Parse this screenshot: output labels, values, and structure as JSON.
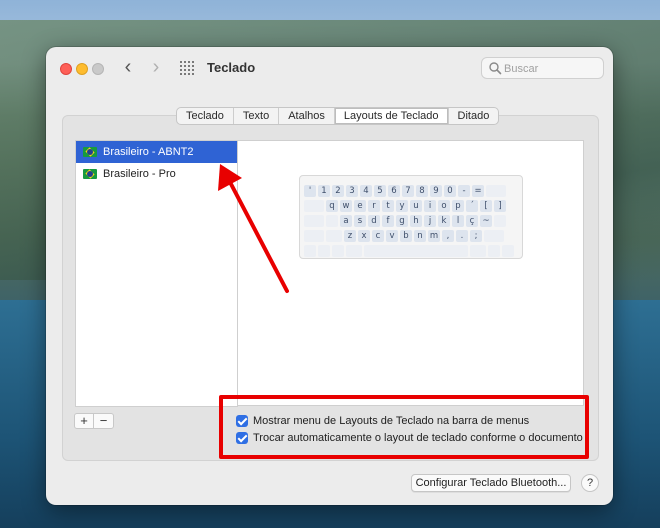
{
  "window": {
    "title": "Teclado",
    "search_placeholder": "Buscar"
  },
  "tabs": [
    {
      "label": "Teclado",
      "active": false
    },
    {
      "label": "Texto",
      "active": false
    },
    {
      "label": "Atalhos",
      "active": false
    },
    {
      "label": "Layouts de Teclado",
      "active": true
    },
    {
      "label": "Ditado",
      "active": false
    }
  ],
  "layouts": [
    {
      "label": "Brasileiro - ABNT2",
      "selected": true,
      "icon": "brazil-flag-icon"
    },
    {
      "label": "Brasileiro - Pro",
      "selected": false,
      "icon": "brazil-flag-icon"
    }
  ],
  "list_controls": {
    "add": "+",
    "remove": "−"
  },
  "keyboard": {
    "row1": [
      "'",
      "1",
      "2",
      "3",
      "4",
      "5",
      "6",
      "7",
      "8",
      "9",
      "0",
      "-",
      "="
    ],
    "row2": [
      "q",
      "w",
      "e",
      "r",
      "t",
      "y",
      "u",
      "i",
      "o",
      "p",
      "´",
      "[",
      "]"
    ],
    "row3": [
      "a",
      "s",
      "d",
      "f",
      "g",
      "h",
      "j",
      "k",
      "l",
      "ç",
      "~"
    ],
    "row4": [
      "z",
      "x",
      "c",
      "v",
      "b",
      "n",
      "m",
      ",",
      ".",
      ";"
    ]
  },
  "options": {
    "show_menu": {
      "label": "Mostrar menu de Layouts de Teclado na barra de menus",
      "checked": true
    },
    "auto_switch": {
      "label": "Trocar automaticamente o layout de teclado conforme o documento",
      "checked": true
    }
  },
  "footer": {
    "bluetooth_button": "Configurar Teclado Bluetooth...",
    "help": "?"
  },
  "colors": {
    "selection": "#2f63d4",
    "annotation": "#e80000",
    "checkbox": "#2f6fe4"
  }
}
